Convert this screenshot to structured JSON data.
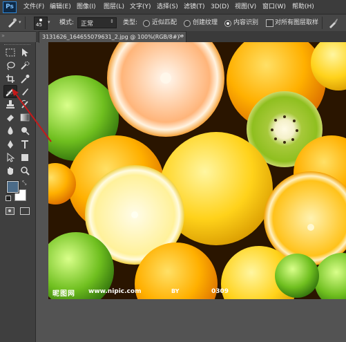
{
  "app": {
    "logo": "Ps"
  },
  "menu": [
    "文件(F)",
    "编辑(E)",
    "图像(I)",
    "图层(L)",
    "文字(Y)",
    "选择(S)",
    "滤镜(T)",
    "3D(D)",
    "视图(V)",
    "窗口(W)",
    "帮助(H)"
  ],
  "options": {
    "brush_size": "45",
    "mode_label": "模式:",
    "mode_value": "正常",
    "type_label": "类型:",
    "type_proximity": "近似匹配",
    "type_texture": "创建纹理",
    "type_content_aware": "内容识别",
    "sample_all_layers": "对所有图层取样"
  },
  "document_tab": {
    "title": "3131626_164655079631_2.jpg @ 100%(RGB/8#) *",
    "close": "×"
  },
  "watermark": {
    "site_cn": "昵图网",
    "url": "www.nipic.com",
    "by": "BY",
    "id": "0309"
  },
  "colors": {
    "foreground": "#4b6b88",
    "background": "#ffffff",
    "annotation_arrow": "#c41a1a",
    "ui_dark": "#535353"
  },
  "icons": {
    "tools": [
      "marquee",
      "move",
      "lasso",
      "quick-select",
      "crop",
      "eyedropper",
      "spot-healing-brush",
      "brush",
      "clone-stamp",
      "history-brush",
      "eraser",
      "gradient",
      "blur",
      "dodge",
      "pen",
      "type",
      "path-select",
      "rectangle",
      "hand",
      "zoom"
    ]
  }
}
